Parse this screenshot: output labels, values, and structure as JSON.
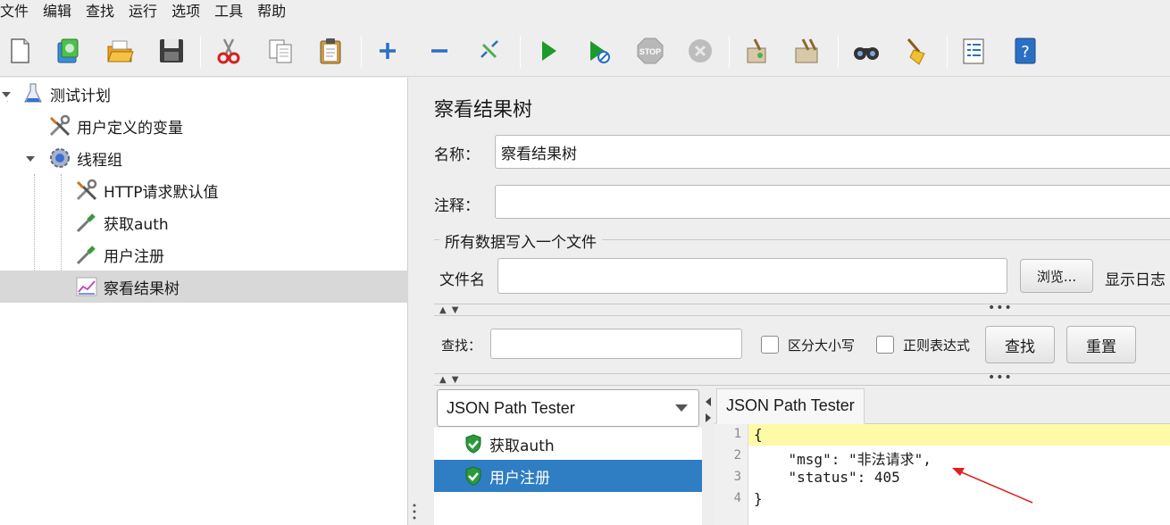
{
  "menu": [
    "文件",
    "编辑",
    "查找",
    "运行",
    "选项",
    "工具",
    "帮助"
  ],
  "toolbar": {
    "icons": [
      "new-icon",
      "templates-icon",
      "open-icon",
      "save-icon",
      "cut-icon",
      "copy-icon",
      "paste-icon",
      "expand-icon",
      "collapse-icon",
      "toggle-icon",
      "start-icon",
      "start-no-pause-icon",
      "stop-icon",
      "shutdown-icon",
      "clear-icon",
      "clear-all-icon",
      "search-icon",
      "reset-search-icon",
      "function-helper-icon",
      "help-icon"
    ],
    "stop_label": "STOP"
  },
  "tree": {
    "items": [
      {
        "label": "测试计划"
      },
      {
        "label": "用户定义的变量"
      },
      {
        "label": "线程组"
      },
      {
        "label": "HTTP请求默认值"
      },
      {
        "label": "获取auth"
      },
      {
        "label": "用户注册"
      },
      {
        "label": "察看结果树"
      }
    ]
  },
  "panel": {
    "title": "察看结果树",
    "name_label": "名称：",
    "name_value": "察看结果树",
    "comment_label": "注释：",
    "comment_value": "",
    "file_section_title": "所有数据写入一个文件",
    "filename_label": "文件名",
    "filename_value": "",
    "browse_label": "浏览...",
    "show_log_label": "显示日志",
    "search_label": "查找：",
    "search_value": "",
    "case_label": "区分大小写",
    "regex_label": "正则表达式",
    "find_button": "查找",
    "reset_button": "重置"
  },
  "results": {
    "renderer": "JSON Path Tester",
    "samples": [
      {
        "label": "获取auth",
        "selected": false
      },
      {
        "label": "用户注册",
        "selected": true
      }
    ],
    "tab_label": "JSON Path Tester",
    "lines": [
      {
        "num": "1",
        "text": "{"
      },
      {
        "num": "2",
        "text": "    \"msg\": \"非法请求\","
      },
      {
        "num": "3",
        "text": "    \"status\": 405"
      },
      {
        "num": "4",
        "text": "}"
      }
    ]
  },
  "colors": {
    "selection_blue": "#2f7dc2",
    "highlight_yellow": "#fffaa8",
    "annotation_red": "#e02020"
  }
}
